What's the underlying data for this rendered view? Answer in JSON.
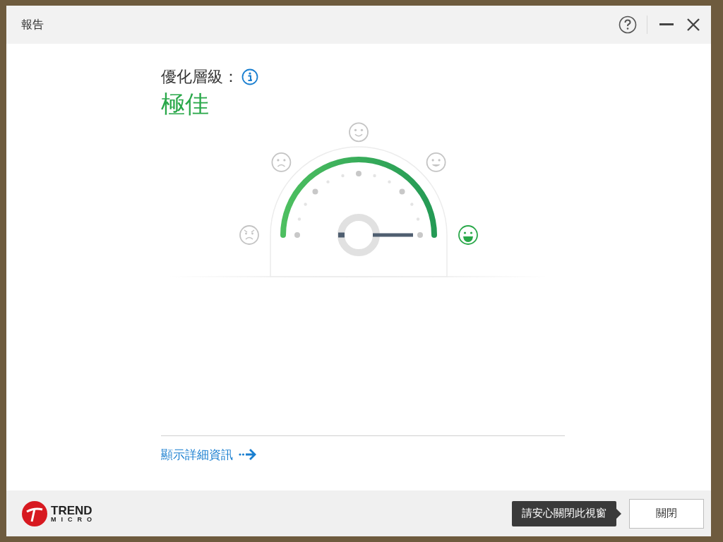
{
  "window": {
    "title": "報告"
  },
  "optimization": {
    "label": "優化層級：",
    "value": "極佳"
  },
  "gauge": {
    "faces": [
      {
        "kind": "angry",
        "selected": false
      },
      {
        "kind": "sad",
        "selected": false
      },
      {
        "kind": "smile",
        "selected": false
      },
      {
        "kind": "happy",
        "selected": false
      },
      {
        "kind": "grin",
        "selected": true
      }
    ]
  },
  "details_link": "顯示詳細資訊",
  "footer": {
    "logo": {
      "line1": "TREND",
      "line2": "MICRO"
    },
    "tooltip": "請安心關閉此視窗",
    "close_button": "關閉"
  }
}
